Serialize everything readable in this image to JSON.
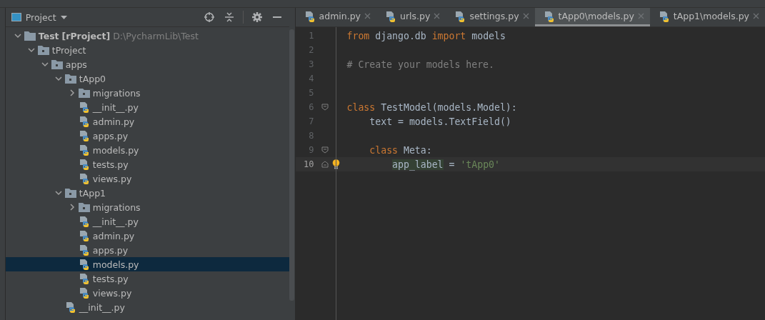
{
  "project_panel": {
    "title": "Project",
    "tree": [
      {
        "kind": "root",
        "name": "Test",
        "module": "[rProject]",
        "path": "D:\\PycharmLib\\Test",
        "expanded": true,
        "selected": false,
        "children": [
          {
            "kind": "folder",
            "name": "tProject",
            "expanded": true,
            "selected": false,
            "children": [
              {
                "kind": "folder",
                "name": "apps",
                "expanded": true,
                "selected": false,
                "children": [
                  {
                    "kind": "folder",
                    "name": "tApp0",
                    "expanded": true,
                    "selected": false,
                    "children": [
                      {
                        "kind": "folder",
                        "name": "migrations",
                        "expanded": false,
                        "selected": false
                      },
                      {
                        "kind": "file",
                        "name": "__init__.py",
                        "selected": false
                      },
                      {
                        "kind": "file",
                        "name": "admin.py",
                        "selected": false
                      },
                      {
                        "kind": "file",
                        "name": "apps.py",
                        "selected": false
                      },
                      {
                        "kind": "file",
                        "name": "models.py",
                        "selected": false
                      },
                      {
                        "kind": "file",
                        "name": "tests.py",
                        "selected": false
                      },
                      {
                        "kind": "file",
                        "name": "views.py",
                        "selected": false
                      }
                    ]
                  },
                  {
                    "kind": "folder",
                    "name": "tApp1",
                    "expanded": true,
                    "selected": false,
                    "children": [
                      {
                        "kind": "folder",
                        "name": "migrations",
                        "expanded": false,
                        "selected": false
                      },
                      {
                        "kind": "file",
                        "name": "__init__.py",
                        "selected": false
                      },
                      {
                        "kind": "file",
                        "name": "admin.py",
                        "selected": false
                      },
                      {
                        "kind": "file",
                        "name": "apps.py",
                        "selected": false
                      },
                      {
                        "kind": "file",
                        "name": "models.py",
                        "selected": true
                      },
                      {
                        "kind": "file",
                        "name": "tests.py",
                        "selected": false
                      },
                      {
                        "kind": "file",
                        "name": "views.py",
                        "selected": false
                      }
                    ]
                  },
                  {
                    "kind": "file",
                    "name": "__init__.py",
                    "selected": false
                  }
                ]
              }
            ]
          }
        ]
      }
    ]
  },
  "editor": {
    "tabs": [
      {
        "label": "admin.py",
        "selected": false
      },
      {
        "label": "urls.py",
        "selected": false
      },
      {
        "label": "settings.py",
        "selected": false
      },
      {
        "label": "tApp0\\models.py",
        "selected": true
      },
      {
        "label": "tApp1\\models.py",
        "selected": false
      }
    ],
    "lines": [
      {
        "number": "1",
        "current": false,
        "tokens": [
          {
            "kind": "keyword",
            "text": "from"
          },
          {
            "kind": "plain",
            "text": " django.db "
          },
          {
            "kind": "keyword",
            "text": "import"
          },
          {
            "kind": "plain",
            "text": " models"
          }
        ]
      },
      {
        "number": "2",
        "current": false
      },
      {
        "number": "3",
        "current": false,
        "tokens": [
          {
            "kind": "comment",
            "text": "# Create your models here."
          }
        ]
      },
      {
        "number": "4",
        "current": false
      },
      {
        "number": "5",
        "current": false
      },
      {
        "number": "6",
        "current": false,
        "fold_start": true,
        "tokens": [
          {
            "kind": "keyword",
            "text": "class"
          },
          {
            "kind": "plain",
            "text": " TestModel(models.Model):"
          }
        ]
      },
      {
        "number": "7",
        "current": false,
        "tokens": [
          {
            "kind": "plain",
            "text": "    text = models.TextField()"
          }
        ]
      },
      {
        "number": "8",
        "current": false
      },
      {
        "number": "9",
        "current": false,
        "fold_start": true,
        "tokens": [
          {
            "kind": "keyword",
            "text": "    class"
          },
          {
            "kind": "plain",
            "text": " Meta:"
          }
        ]
      },
      {
        "number": "10",
        "current": true,
        "fold_end": true,
        "intention": true,
        "tokens": [
          {
            "kind": "usage",
            "text": "        app_label"
          },
          {
            "kind": "plain",
            "text": " = "
          },
          {
            "kind": "string",
            "text": "'tApp0'"
          }
        ]
      }
    ]
  }
}
